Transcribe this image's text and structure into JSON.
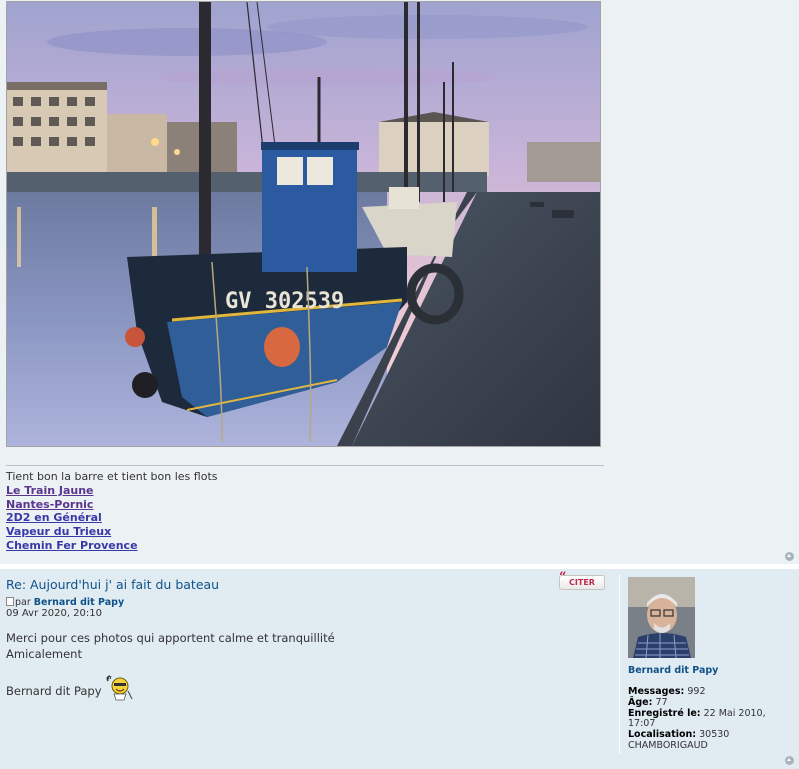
{
  "post1": {
    "image_alt": "photo",
    "signature": {
      "motto": "Tient bon la barre et tient bon les flots",
      "links": [
        "Le Train Jaune",
        "Nantes-Pornic",
        "2D2 en Général",
        "Vapeur du Trieux",
        "Chemin Fer Provence"
      ]
    },
    "boat_registration": "GV 302539"
  },
  "post2": {
    "title": "Re: Aujourd'hui j' ai fait du bateau",
    "quote_label": "CITER",
    "by_prefix": "par ",
    "author": "Bernard dit Papy",
    "date": "09 Avr 2020, 20:10",
    "content": {
      "line1": "Merci pour ces photos qui apportent calme et tranquillité",
      "line2": "Amicalement",
      "line3": "Bernard dit Papy"
    },
    "profile": {
      "name": "Bernard dit Papy",
      "messages_label": "Messages:",
      "messages_value": "992",
      "age_label": "Âge:",
      "age_value": "77",
      "registered_label": "Enregistré le:",
      "registered_value": "22 Mai 2010, 17:07",
      "location_label": "Localisation:",
      "location_value": "30530 CHAMBORIGAUD"
    }
  },
  "icons": {
    "top": "arrow-up-icon",
    "quote": "quote-icon",
    "post": "post-icon",
    "smiley": "smiley-icon"
  }
}
